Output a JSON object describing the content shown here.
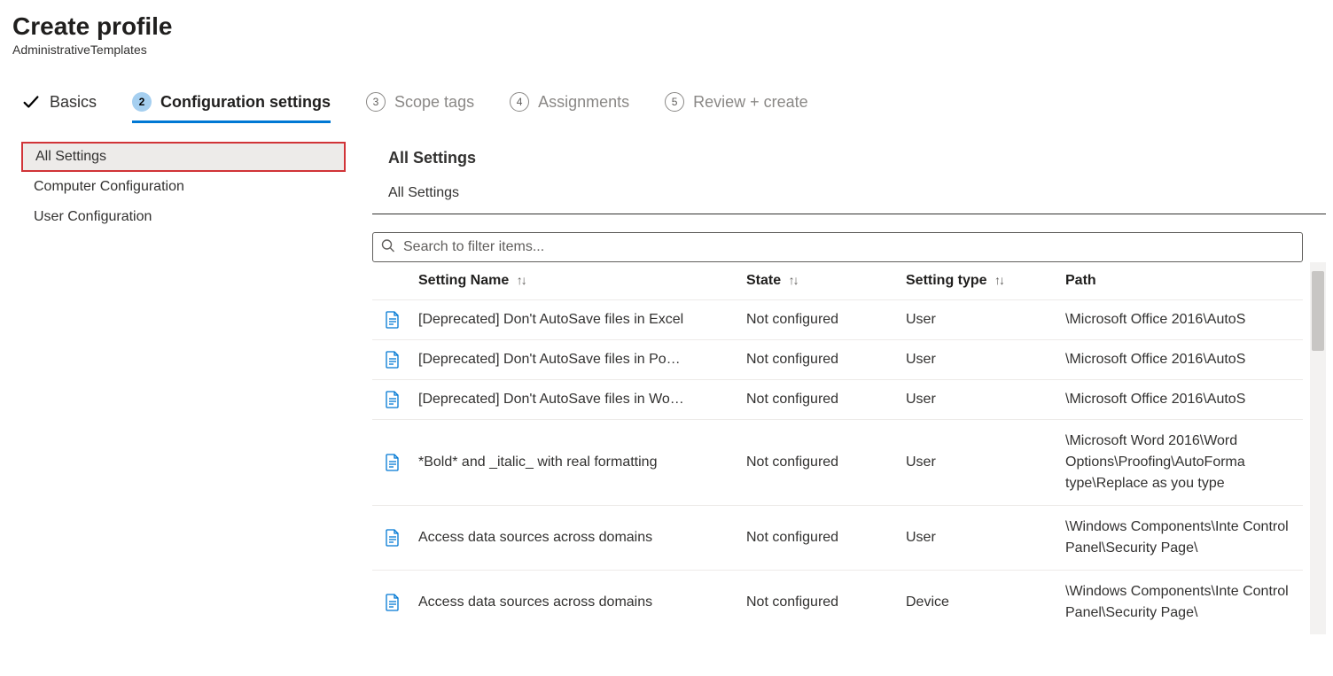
{
  "header": {
    "title": "Create profile",
    "subtitle": "AdministrativeTemplates"
  },
  "steps": [
    {
      "label": "Basics",
      "state": "done",
      "num": ""
    },
    {
      "label": "Configuration settings",
      "state": "active",
      "num": "2"
    },
    {
      "label": "Scope tags",
      "state": "future",
      "num": "3"
    },
    {
      "label": "Assignments",
      "state": "future",
      "num": "4"
    },
    {
      "label": "Review + create",
      "state": "future",
      "num": "5"
    }
  ],
  "tree": [
    {
      "label": "All Settings",
      "selected": true
    },
    {
      "label": "Computer Configuration",
      "selected": false
    },
    {
      "label": "User Configuration",
      "selected": false
    }
  ],
  "main": {
    "title": "All Settings",
    "breadcrumb": "All Settings",
    "search_placeholder": "Search to filter items...",
    "columns": {
      "name": "Setting Name",
      "state": "State",
      "type": "Setting type",
      "path": "Path"
    },
    "rows": [
      {
        "name": "[Deprecated] Don't AutoSave files in Excel",
        "state": "Not configured",
        "type": "User",
        "path": "\\Microsoft Office 2016\\AutoS",
        "wrap": false
      },
      {
        "name": "[Deprecated] Don't AutoSave files in Po…",
        "state": "Not configured",
        "type": "User",
        "path": "\\Microsoft Office 2016\\AutoS",
        "wrap": false
      },
      {
        "name": "[Deprecated] Don't AutoSave files in Wo…",
        "state": "Not configured",
        "type": "User",
        "path": "\\Microsoft Office 2016\\AutoS",
        "wrap": false
      },
      {
        "name": "*Bold* and _italic_ with real formatting",
        "state": "Not configured",
        "type": "User",
        "path": "\\Microsoft Word 2016\\Word Options\\Proofing\\AutoForma type\\Replace as you type",
        "wrap": true
      },
      {
        "name": "Access data sources across domains",
        "state": "Not configured",
        "type": "User",
        "path": "\\Windows Components\\Inte Control Panel\\Security Page\\",
        "wrap": true
      },
      {
        "name": "Access data sources across domains",
        "state": "Not configured",
        "type": "Device",
        "path": "\\Windows Components\\Inte Control Panel\\Security Page\\",
        "wrap": true
      }
    ]
  }
}
